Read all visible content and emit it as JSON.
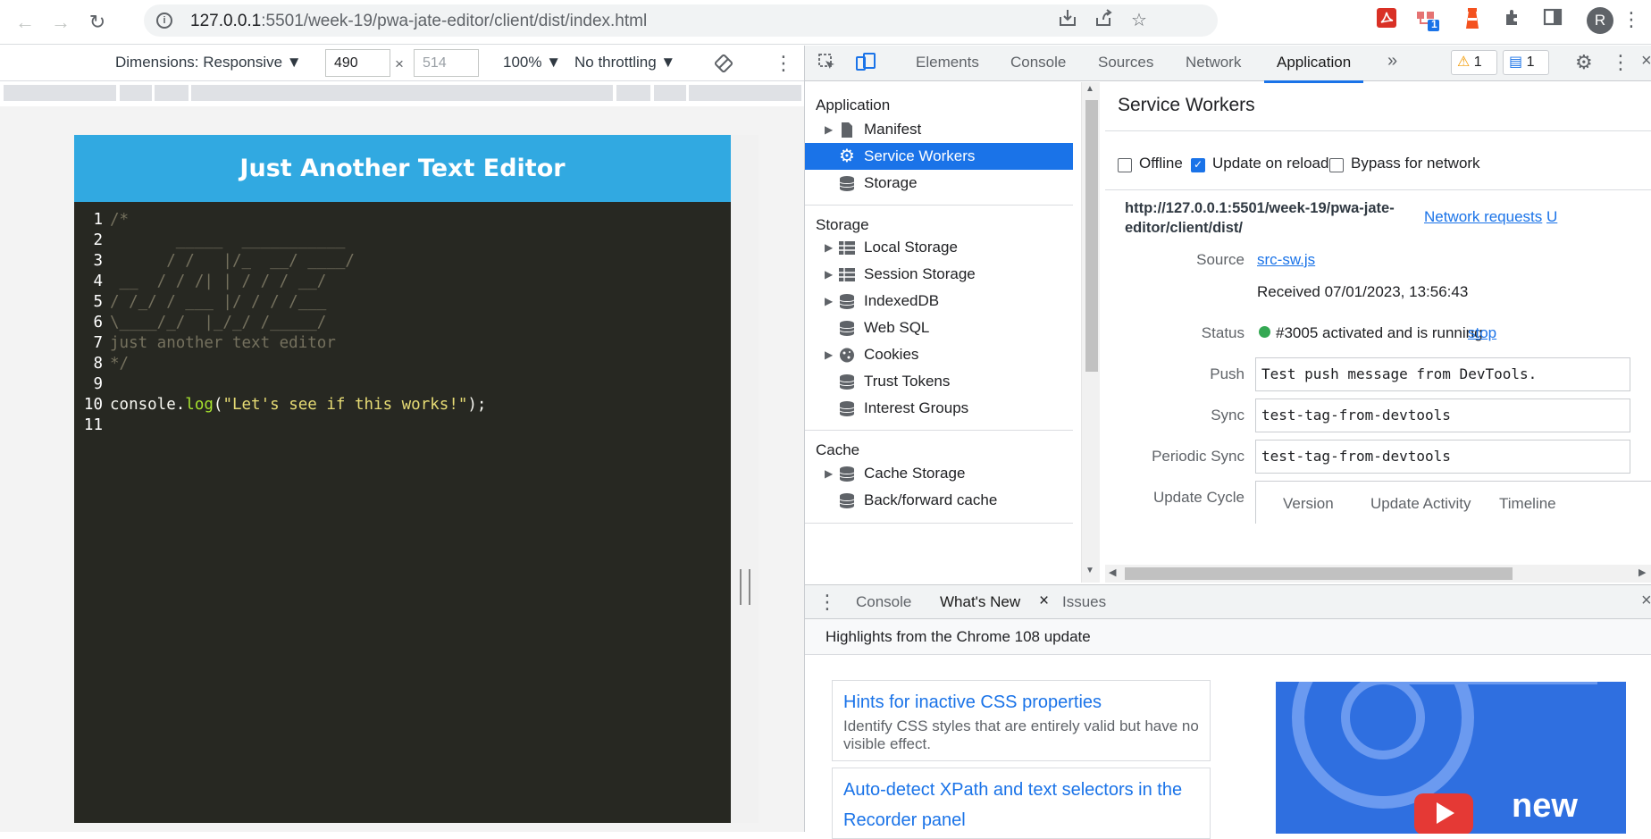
{
  "browser": {
    "url_host": "127.0.0.1",
    "url_rest": ":5501/week-19/pwa-jate-editor/client/dist/index.html",
    "avatar_letter": "R",
    "ext_badge": "1"
  },
  "device_toolbar": {
    "dimensions_label": "Dimensions: Responsive ▼",
    "width": "490",
    "times": "×",
    "height_placeholder": "514",
    "zoom": "100% ▼",
    "throttle": "No throttling ▼"
  },
  "app": {
    "title": "Just Another Text Editor",
    "code_lines": [
      {
        "n": "1",
        "text": "/*",
        "cls": "cm"
      },
      {
        "n": "2",
        "text": "       _____  ___________",
        "cls": "cm"
      },
      {
        "n": "3",
        "text": "      / /   |/_  __/ ____/",
        "cls": "cm"
      },
      {
        "n": "4",
        "text": " __  / / /| | / / / __/",
        "cls": "cm"
      },
      {
        "n": "5",
        "text": "/ /_/ / ___ |/ / / /___",
        "cls": "cm"
      },
      {
        "n": "6",
        "text": "\\____/_/  |_/_/ /_____/",
        "cls": "cm"
      },
      {
        "n": "7",
        "text": "just another text editor",
        "cls": "cm"
      },
      {
        "n": "8",
        "text": "*/",
        "cls": "cm"
      },
      {
        "n": "9",
        "text": "",
        "cls": "cm"
      },
      {
        "n": "10",
        "text": "",
        "cls": "code"
      },
      {
        "n": "11",
        "text": "",
        "cls": "cm"
      }
    ],
    "code_line10": {
      "obj": "console.",
      "fn": "log",
      "open": "(",
      "str": "\"Let's see if this works!\"",
      "close": ");"
    }
  },
  "devtools": {
    "tabs": [
      "Elements",
      "Console",
      "Sources",
      "Network",
      "Application"
    ],
    "more": "»",
    "warnings": "1",
    "messages": "1",
    "sidebar": {
      "application_header": "Application",
      "application_items": [
        "Manifest",
        "Service Workers",
        "Storage"
      ],
      "storage_header": "Storage",
      "storage_items": [
        "Local Storage",
        "Session Storage",
        "IndexedDB",
        "Web SQL",
        "Cookies",
        "Trust Tokens",
        "Interest Groups"
      ],
      "cache_header": "Cache",
      "cache_items": [
        "Cache Storage",
        "Back/forward cache"
      ]
    },
    "sw": {
      "title": "Service Workers",
      "offline": "Offline",
      "update_on_reload": "Update on reload",
      "bypass": "Bypass for network",
      "scope": "http://127.0.0.1:5501/week-19/pwa-jate-editor/client/dist/",
      "network_requests": "Network requests",
      "cut_link": "U",
      "source_label": "Source",
      "source_link": "src-sw.js",
      "received": "Received 07/01/2023, 13:56:43",
      "status_label": "Status",
      "status_text": "#3005 activated and is running",
      "stop": "stop",
      "push_label": "Push",
      "push_value": "Test push message from DevTools.",
      "sync_label": "Sync",
      "sync_value": "test-tag-from-devtools",
      "periodic_label": "Periodic Sync",
      "periodic_value": "test-tag-from-devtools",
      "update_cycle_label": "Update Cycle",
      "cycle_cols": [
        "Version",
        "Update Activity",
        "Timeline"
      ]
    },
    "drawer": {
      "tabs": [
        "Console",
        "What's New",
        "Issues"
      ],
      "close": "×",
      "highlights": "Highlights from the Chrome 108 update",
      "card1_title": "Hints for inactive CSS properties",
      "card1_desc": "Identify CSS styles that are entirely valid but have no visible effect.",
      "card2_title": "Auto-detect XPath and text selectors in the Recorder panel",
      "video_text": "new"
    }
  },
  "colors": {
    "accent": "#1a73e8",
    "header": "#31a9e1",
    "editor_bg": "#272822"
  }
}
